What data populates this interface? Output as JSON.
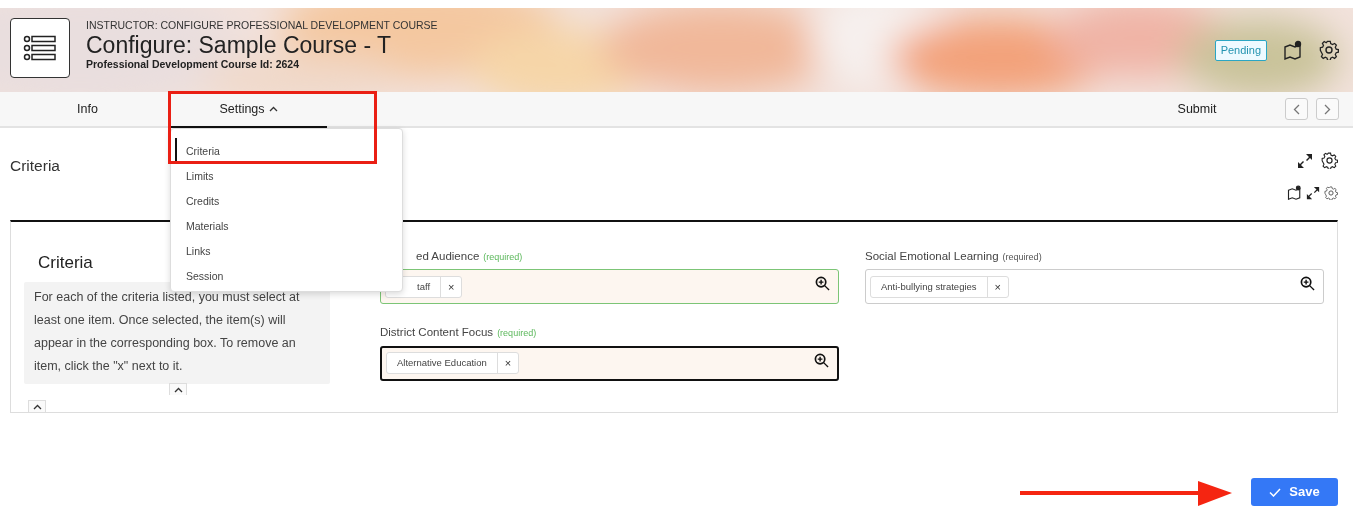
{
  "header": {
    "breadcrumb": "INSTRUCTOR: CONFIGURE PROFESSIONAL DEVELOPMENT COURSE",
    "title": "Configure: Sample Course - T",
    "subtitle": "Professional Development Course Id: 2624",
    "status": "Pending"
  },
  "tabs": [
    {
      "label": "Info",
      "selected": false
    },
    {
      "label": "Settings",
      "selected": true,
      "expanded": true
    }
  ],
  "submit": "Submit",
  "settings_menu": [
    {
      "label": "Criteria",
      "selected": true
    },
    {
      "label": "Limits",
      "selected": false
    },
    {
      "label": "Credits",
      "selected": false
    },
    {
      "label": "Materials",
      "selected": false
    },
    {
      "label": "Links",
      "selected": false
    },
    {
      "label": "Session",
      "selected": false
    }
  ],
  "section_title": "Criteria",
  "criteria": {
    "title": "Criteria",
    "instructions": "For each of the criteria listed, you must select at least one item. Once selected, the item(s) will appear in the corresponding box. To remove an item, click the \"x\" next to it."
  },
  "fields": [
    {
      "label": "ed Audience",
      "required": "(required)",
      "valid": true,
      "focused": false,
      "chips": [
        {
          "text": "taff",
          "remove": "×"
        }
      ]
    },
    {
      "label": "District Content Focus",
      "required": "(required)",
      "valid": true,
      "focused": true,
      "chips": [
        {
          "text": "Alternative Education",
          "remove": "×"
        }
      ]
    },
    {
      "label": "Social Emotional Learning",
      "required": "(required)",
      "valid": false,
      "focused": false,
      "chips": [
        {
          "text": "Anti-bullying strategies",
          "remove": "×"
        }
      ]
    }
  ],
  "save": "Save"
}
